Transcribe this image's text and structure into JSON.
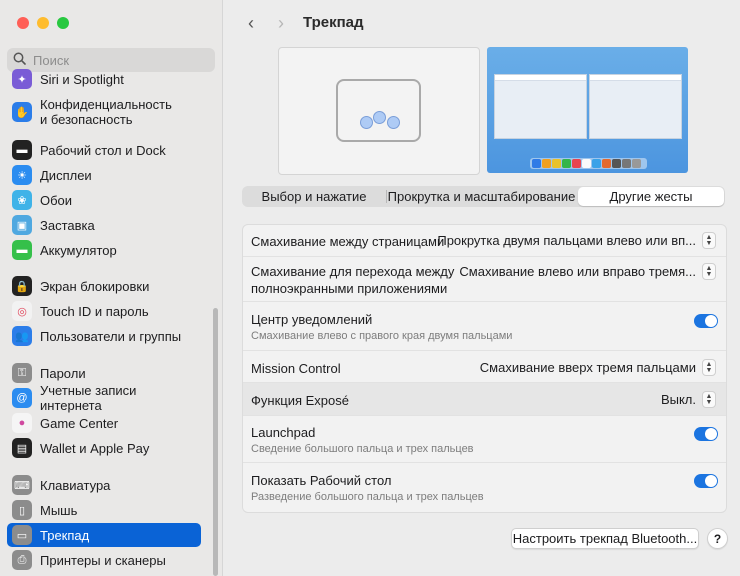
{
  "window": {
    "title": "Трекпад"
  },
  "traffic_lights": {
    "close": "#ff5f57",
    "minimize": "#febc2e",
    "zoom": "#28c840"
  },
  "search": {
    "placeholder": "Поиск"
  },
  "sidebar": {
    "items": [
      {
        "label": "Siri и Spotlight",
        "icon": "siri-icon",
        "color": "#7a5cd6"
      },
      {
        "label": "Конфиденциальность\nи безопасность",
        "icon": "privacy-hand-icon",
        "color": "#2b7de9"
      },
      {
        "label": "Рабочий стол и Dock",
        "icon": "desktop-dock-icon",
        "color": "#222222"
      },
      {
        "label": "Дисплеи",
        "icon": "display-icon",
        "color": "#2b8cf0"
      },
      {
        "label": "Обои",
        "icon": "wallpaper-icon",
        "color": "#3fb3e8"
      },
      {
        "label": "Заставка",
        "icon": "screensaver-icon",
        "color": "#4fa8e0"
      },
      {
        "label": "Аккумулятор",
        "icon": "battery-icon",
        "color": "#35c04a"
      },
      {
        "label": "Экран блокировки",
        "icon": "lock-icon",
        "color": "#222222"
      },
      {
        "label": "Touch ID и пароль",
        "icon": "fingerprint-icon",
        "color": "#f2f2f2"
      },
      {
        "label": "Пользователи и группы",
        "icon": "users-icon",
        "color": "#2b7de9"
      },
      {
        "label": "Пароли",
        "icon": "key-icon",
        "color": "#8c8c8c"
      },
      {
        "label": "Учетные записи интернета",
        "icon": "at-icon",
        "color": "#2b8cf0"
      },
      {
        "label": "Game Center",
        "icon": "game-center-icon",
        "color": "#f5f5f5"
      },
      {
        "label": "Wallet и Apple Pay",
        "icon": "wallet-icon",
        "color": "#222222"
      },
      {
        "label": "Клавиатура",
        "icon": "keyboard-icon",
        "color": "#8c8c8c"
      },
      {
        "label": "Мышь",
        "icon": "mouse-icon",
        "color": "#8c8c8c"
      },
      {
        "label": "Трекпад",
        "icon": "trackpad-icon",
        "color": "#8c8c8c",
        "selected": true
      },
      {
        "label": "Принтеры и сканеры",
        "icon": "printer-icon",
        "color": "#8c8c8c"
      }
    ]
  },
  "tabs": [
    {
      "label": "Выбор и нажатие",
      "active": false
    },
    {
      "label": "Прокрутка и масштабирование",
      "active": false
    },
    {
      "label": "Другие жесты",
      "active": true
    }
  ],
  "settings": [
    {
      "label": "Смахивание между страницами",
      "value": "Прокрутка двумя пальцами влево или вп...",
      "control": "popup"
    },
    {
      "label": "Смахивание для перехода между\nполноэкранными приложениями",
      "value": "Смахивание влево или вправо тремя...",
      "control": "popup"
    },
    {
      "label": "Центр уведомлений",
      "sub": "Смахивание влево с правого края двумя пальцами",
      "control": "toggle",
      "on": true
    },
    {
      "label": "Mission Control",
      "value": "Смахивание вверх тремя пальцами",
      "control": "popup"
    },
    {
      "label": "Функция Exposé",
      "value": "Выкл.",
      "control": "popup",
      "highlighted": true
    },
    {
      "label": "Launchpad",
      "sub": "Сведение большого пальца и трех пальцев",
      "control": "toggle",
      "on": true
    },
    {
      "label": "Показать Рабочий стол",
      "sub": "Разведение большого пальца и трех пальцев",
      "control": "toggle",
      "on": true
    }
  ],
  "footer": {
    "bluetooth_button": "Настроить трекпад Bluetooth...",
    "help": "?"
  },
  "accent_color": "#0a63d6"
}
